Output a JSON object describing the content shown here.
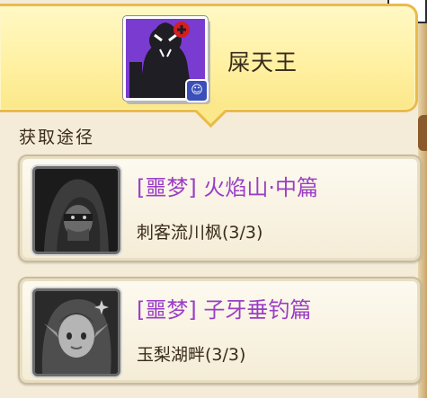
{
  "hero": {
    "name": "屎天王",
    "badge_icon": "ghost-icon",
    "portrait_bg": "#7a3bd1"
  },
  "section": {
    "title": "获取途径"
  },
  "sources": [
    {
      "title": "[噩梦] 火焰山·中篇",
      "subtitle": "刺客流川枫(3/3)",
      "thumb_icon": "hooded-assassin-portrait"
    },
    {
      "title": "[噩梦] 子牙垂钓篇",
      "subtitle": "玉梨湖畔(3/3)",
      "thumb_icon": "elf-girl-portrait"
    }
  ],
  "colors": {
    "header_bg": "#fff0a0",
    "header_border": "#e9bb4a",
    "stage_title": "#9b3ec6",
    "text": "#3a2a1a"
  }
}
